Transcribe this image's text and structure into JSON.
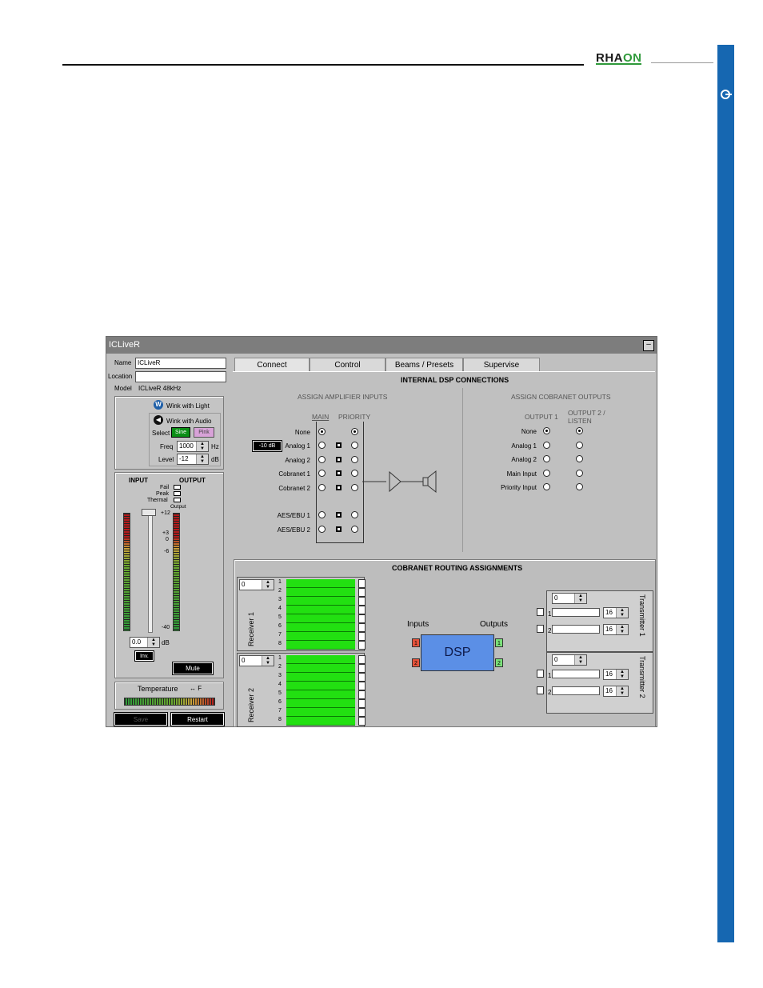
{
  "header": {
    "logo_prefix": "RHA",
    "logo_suffix": "ON"
  },
  "window": {
    "title": "ICLiveR",
    "minimize_glyph": "–",
    "name_label": "Name",
    "name_value": "ICLiveR",
    "location_label": "Location",
    "location_value": "",
    "model_label": "Model",
    "model_value": "ICLiveR 48kHz"
  },
  "wink": {
    "light_label": "Wink with Light",
    "audio_label": "Wink with Audio",
    "select_label": "Select",
    "sine_label": "Sine",
    "pink_label": "Pink",
    "freq_label": "Freq",
    "freq_value": "1000",
    "freq_unit": "Hz",
    "level_label": "Level",
    "level_value": "-12",
    "level_unit": "dB"
  },
  "meters": {
    "input_label": "INPUT",
    "output_label": "OUTPUT",
    "fail_label": "Fail",
    "peak_label": "Peak",
    "thermal_label": "Thermal",
    "output_sub_label": "Output",
    "scale": [
      "+12",
      "+3",
      "0",
      "-6",
      "-40"
    ],
    "gain_value": "0.0",
    "gain_unit": "dB",
    "inv_label": "Inv.",
    "mute_label": "Mute",
    "temperature_label": "Temperature",
    "temperature_unit": "↔ F",
    "save_label": "Save",
    "restart_label": "Restart"
  },
  "tabs": [
    {
      "label": "Connect"
    },
    {
      "label": "Control"
    },
    {
      "label": "Beams / Presets"
    },
    {
      "label": "Supervise"
    }
  ],
  "connect": {
    "title": "INTERNAL DSP CONNECTIONS",
    "amp_inputs_title": "ASSIGN AMPLIFIER INPUTS",
    "main_col": "MAIN",
    "priority_col": "PRIORITY",
    "attenuation_badge": "-10 dB",
    "amp_rows": [
      "None",
      "Analog 1",
      "Analog 2",
      "Cobranet 1",
      "Cobranet 2",
      "AES/EBU 1",
      "AES/EBU 2"
    ],
    "cobranet_outputs_title": "ASSIGN COBRANET OUTPUTS",
    "output1_col": "OUTPUT 1",
    "output2_col": "OUTPUT 2 / LISTEN",
    "out_rows": [
      "None",
      "Analog 1",
      "Analog 2",
      "Main Input",
      "Priority Input"
    ]
  },
  "routing": {
    "title": "COBRANET ROUTING ASSIGNMENTS",
    "receiver1_label": "Receiver 1",
    "receiver2_label": "Receiver 2",
    "receiver1_value": "0",
    "receiver2_value": "0",
    "channels": [
      "1",
      "2",
      "3",
      "4",
      "5",
      "6",
      "7",
      "8"
    ],
    "inputs_label": "Inputs",
    "outputs_label": "Outputs",
    "dsp_label": "DSP",
    "port1": "1",
    "port2": "2",
    "transmitter1_label": "Transmitter 1",
    "transmitter2_label": "Transmitter 2",
    "transmitter1_value": "0",
    "transmitter2_value": "0",
    "tx_count": "16",
    "colors": {
      "rx_green": "#22e011",
      "dsp_blue": "#5b8fe6",
      "in_red": "#e5533b",
      "out_green": "#7ae07a"
    }
  }
}
